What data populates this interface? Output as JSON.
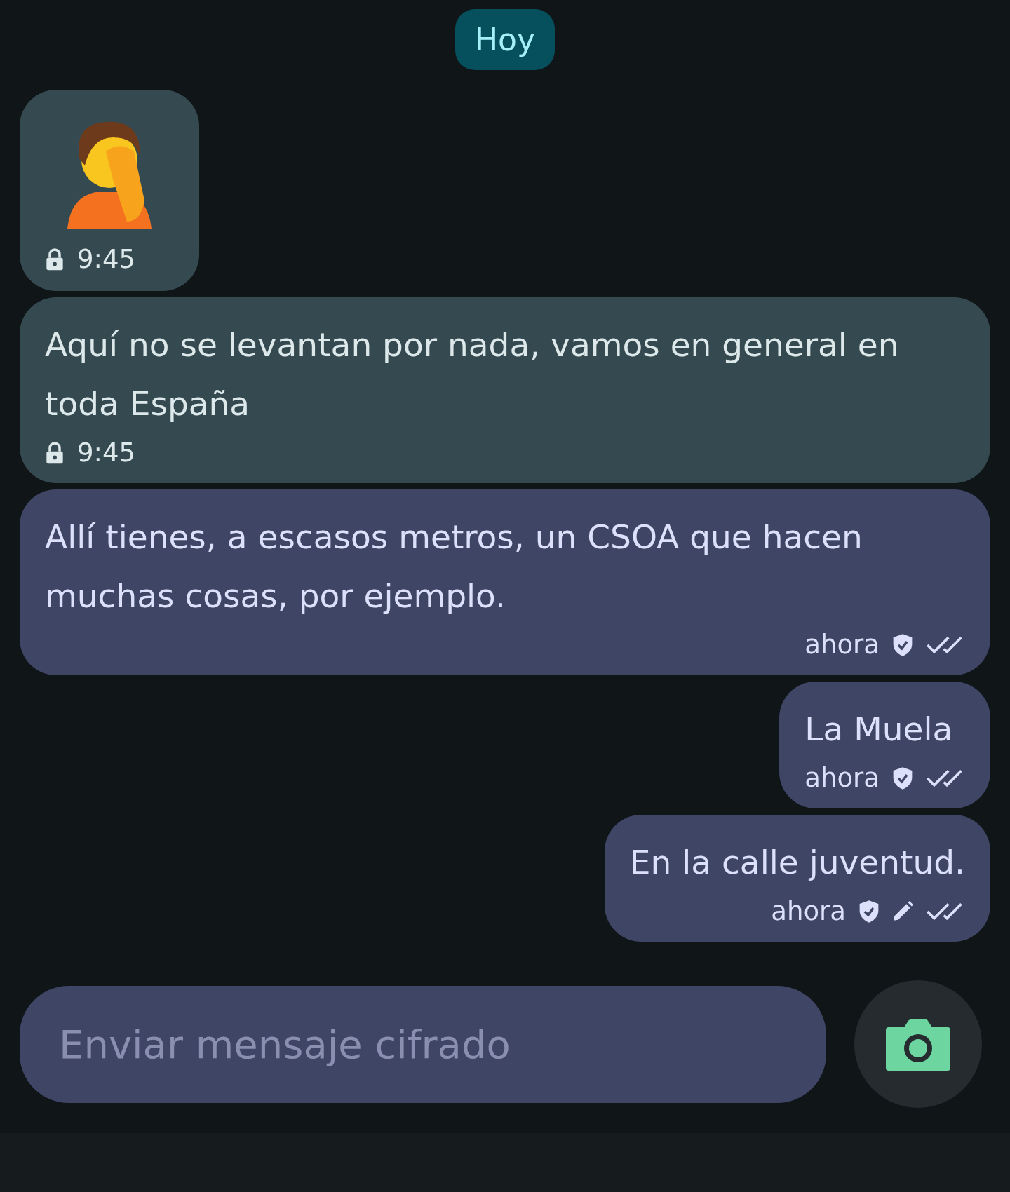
{
  "date_divider": "Hoy",
  "messages": [
    {
      "outgoing": false,
      "kind": "emoji",
      "time": "9:45"
    },
    {
      "outgoing": false,
      "kind": "text",
      "text": "Aquí no se levantan por nada, vamos en general en toda España",
      "time": "9:45"
    },
    {
      "outgoing": true,
      "kind": "text",
      "text": "Allí tienes, a escasos metros, un CSOA que hacen muchas cosas, por ejemplo.",
      "time": "ahora",
      "edited": false,
      "delivered": true
    },
    {
      "outgoing": true,
      "kind": "text",
      "text": "La Muela",
      "time": "ahora",
      "edited": false,
      "delivered": true
    },
    {
      "outgoing": true,
      "kind": "text",
      "text": "En la calle juventud.",
      "time": "ahora",
      "edited": true,
      "delivered": true
    }
  ],
  "composer": {
    "placeholder": "Enviar mensaje cifrado"
  }
}
